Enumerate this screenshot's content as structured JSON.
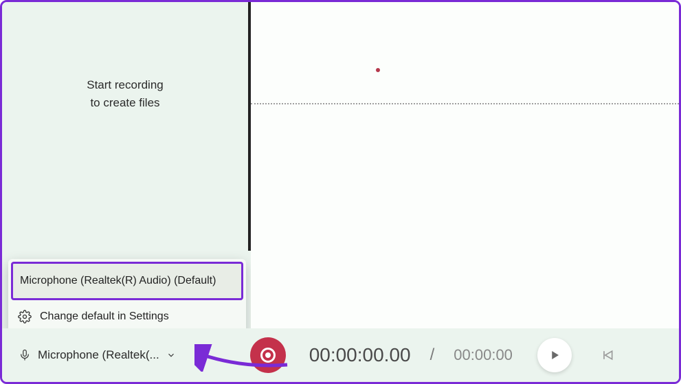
{
  "sidebar": {
    "hint_line1": "Start recording",
    "hint_line2": "to create files"
  },
  "menu": {
    "option_label": "Microphone (Realtek(R) Audio) (Default)",
    "settings_label": "Change default in Settings"
  },
  "bottombar": {
    "mic_label": "Microphone (Realtek(...",
    "time_current": "00:00:00.00",
    "time_separator": "/",
    "time_total": "00:00:00"
  }
}
